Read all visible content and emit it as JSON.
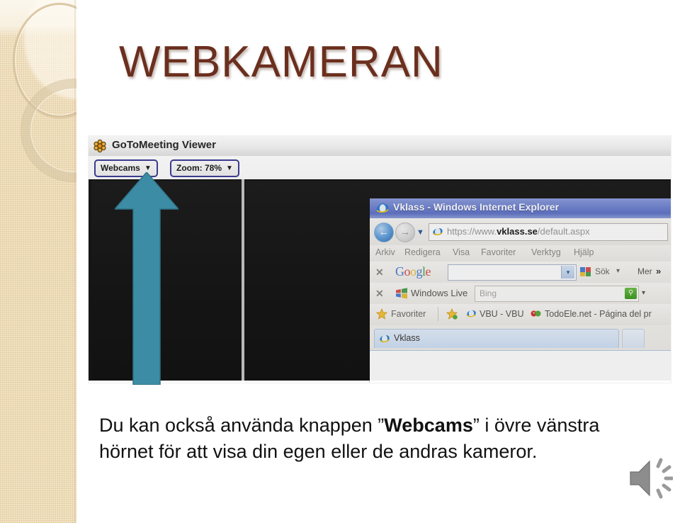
{
  "slide": {
    "title": "WEBKAMERAN",
    "title_color": "#6b2f1e",
    "background_color": "#ffffff",
    "sidebar_color": "#f2e4c6"
  },
  "screenshot": {
    "gotomeeting": {
      "app_title": "GoToMeeting Viewer",
      "app_icon": "flower-icon",
      "buttons": [
        {
          "label": "Webcams",
          "caret": "▼"
        },
        {
          "label": "Zoom: 78%",
          "caret": "▼"
        }
      ],
      "video_panes": 2
    },
    "internet_explorer": {
      "window_title": "Vklass - Windows Internet Explorer",
      "back_arrow": "←",
      "forward_arrow": "→",
      "history_caret": "▼",
      "url": {
        "scheme": "https://www.",
        "domain": "vklass.se",
        "path": "/default.aspx",
        "full": "https://www.vklass.se/default.aspx"
      },
      "menu_items": [
        "Arkiv",
        "Redigera",
        "Visa",
        "Favoriter",
        "Verktyg",
        "Hjälp"
      ],
      "google_toolbar": {
        "close": "✕",
        "brand_letters": [
          "G",
          "o",
          "o",
          "g",
          "l",
          "e"
        ],
        "search_value": "",
        "dropdown_caret": "▾",
        "search_label": "Sök",
        "search_caret": "▾",
        "more_label": "Mer",
        "more_chevron": "»"
      },
      "windows_live_toolbar": {
        "close": "✕",
        "label": "Windows Live",
        "search_placeholder": "Bing",
        "search_icon": "magnifier-icon",
        "caret": "▾"
      },
      "favorites_bar": {
        "label": "Favoriter",
        "items": [
          {
            "label": "VBU - VBU",
            "icon": "page-icon"
          },
          {
            "label": "TodoEle.net - Página del pr",
            "icon": "bookmark-icon"
          }
        ]
      },
      "tabs": [
        {
          "label": "Vklass",
          "icon": "ie-icon",
          "active": true
        }
      ],
      "new_tab_label": ""
    }
  },
  "annotation": {
    "arrow_direction": "up",
    "arrow_color": "#3d8ca6",
    "points_to": "Webcams"
  },
  "caption": {
    "part1": "Du kan också använda knappen ”",
    "bold": "Webcams",
    "part2": "” i övre vänstra hörnet för att visa din egen eller de andras kameror."
  },
  "media": {
    "speaker_icon": "speaker-audio-icon"
  }
}
